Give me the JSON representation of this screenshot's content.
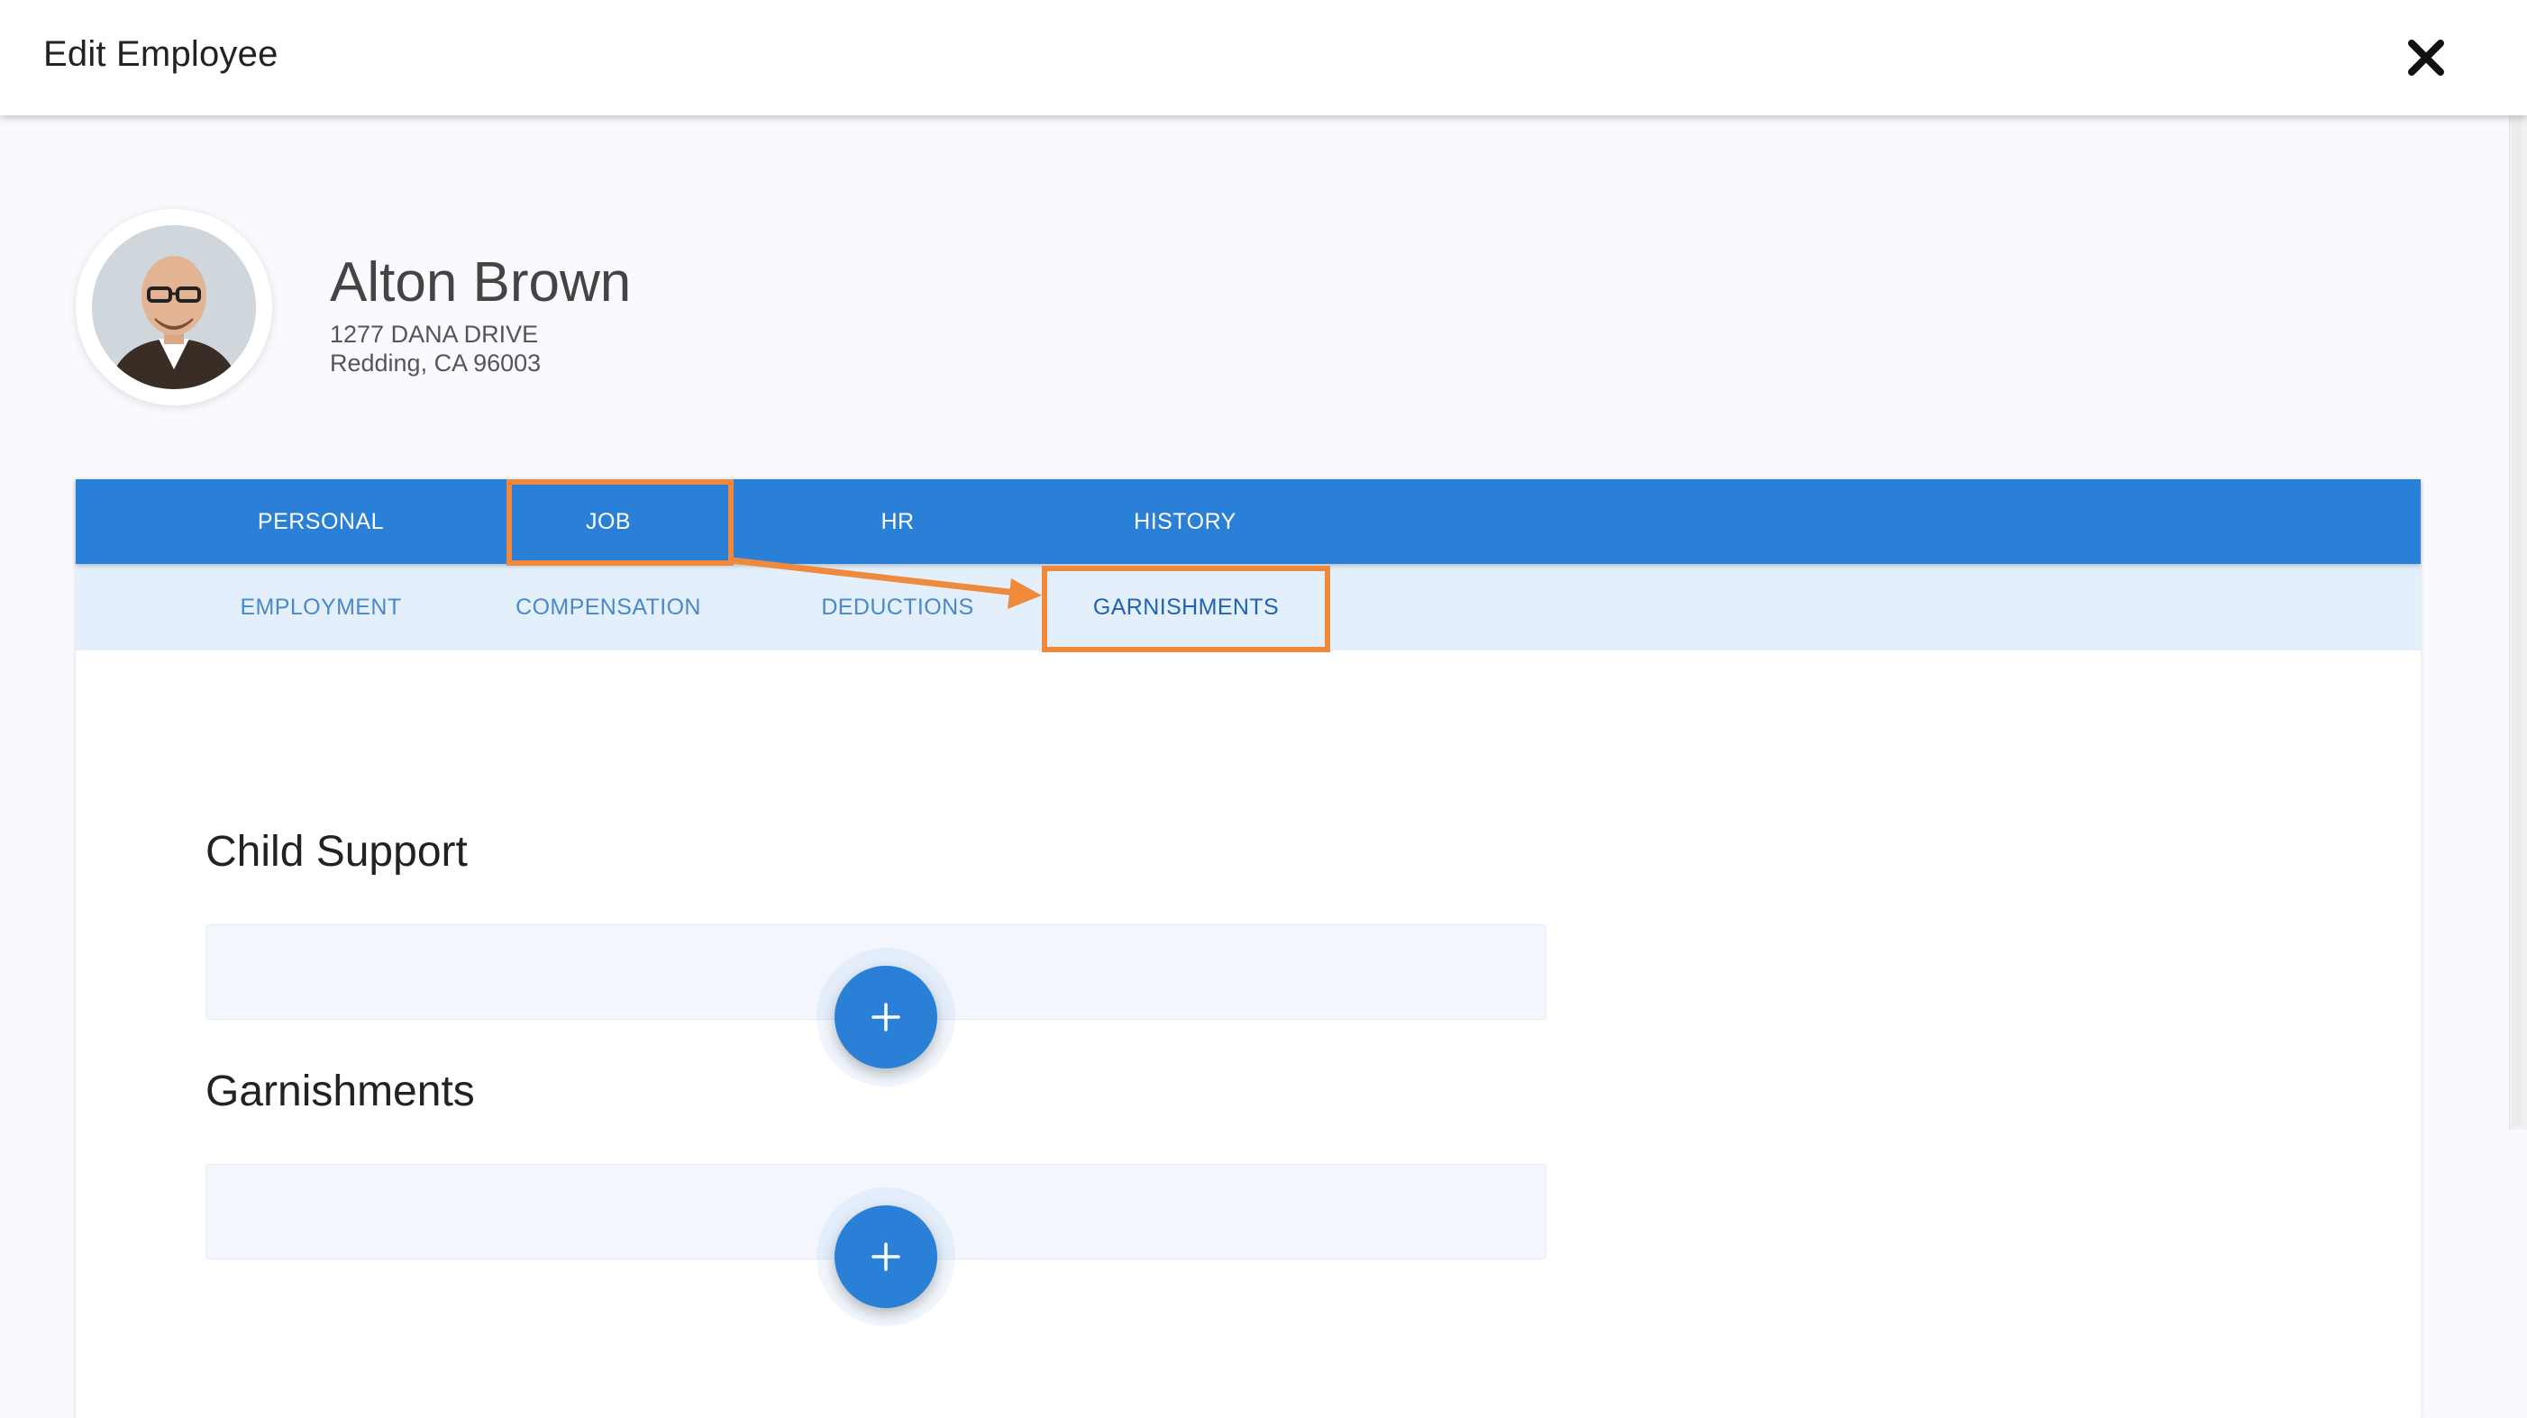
{
  "header": {
    "title": "Edit Employee",
    "close_icon": "close-icon"
  },
  "employee": {
    "name": "Alton Brown",
    "address_line1": "1277 DANA DRIVE",
    "address_line2": "Redding, CA 96003",
    "avatar_icon": "avatar-photo"
  },
  "tabs": [
    {
      "label": "PERSONAL"
    },
    {
      "label": "JOB",
      "selected": true
    },
    {
      "label": "HR"
    },
    {
      "label": "HISTORY"
    }
  ],
  "subtabs": [
    {
      "label": "EMPLOYMENT"
    },
    {
      "label": "COMPENSATION"
    },
    {
      "label": "DEDUCTIONS"
    },
    {
      "label": "GARNISHMENTS",
      "selected": true
    }
  ],
  "sections": [
    {
      "title": "Child Support",
      "add_icon": "plus-icon"
    },
    {
      "title": "Garnishments",
      "add_icon": "plus-icon"
    }
  ],
  "colors": {
    "primary": "#2a7fd6",
    "subbar": "#e3f0fc",
    "highlight": "#ef8a3c"
  }
}
